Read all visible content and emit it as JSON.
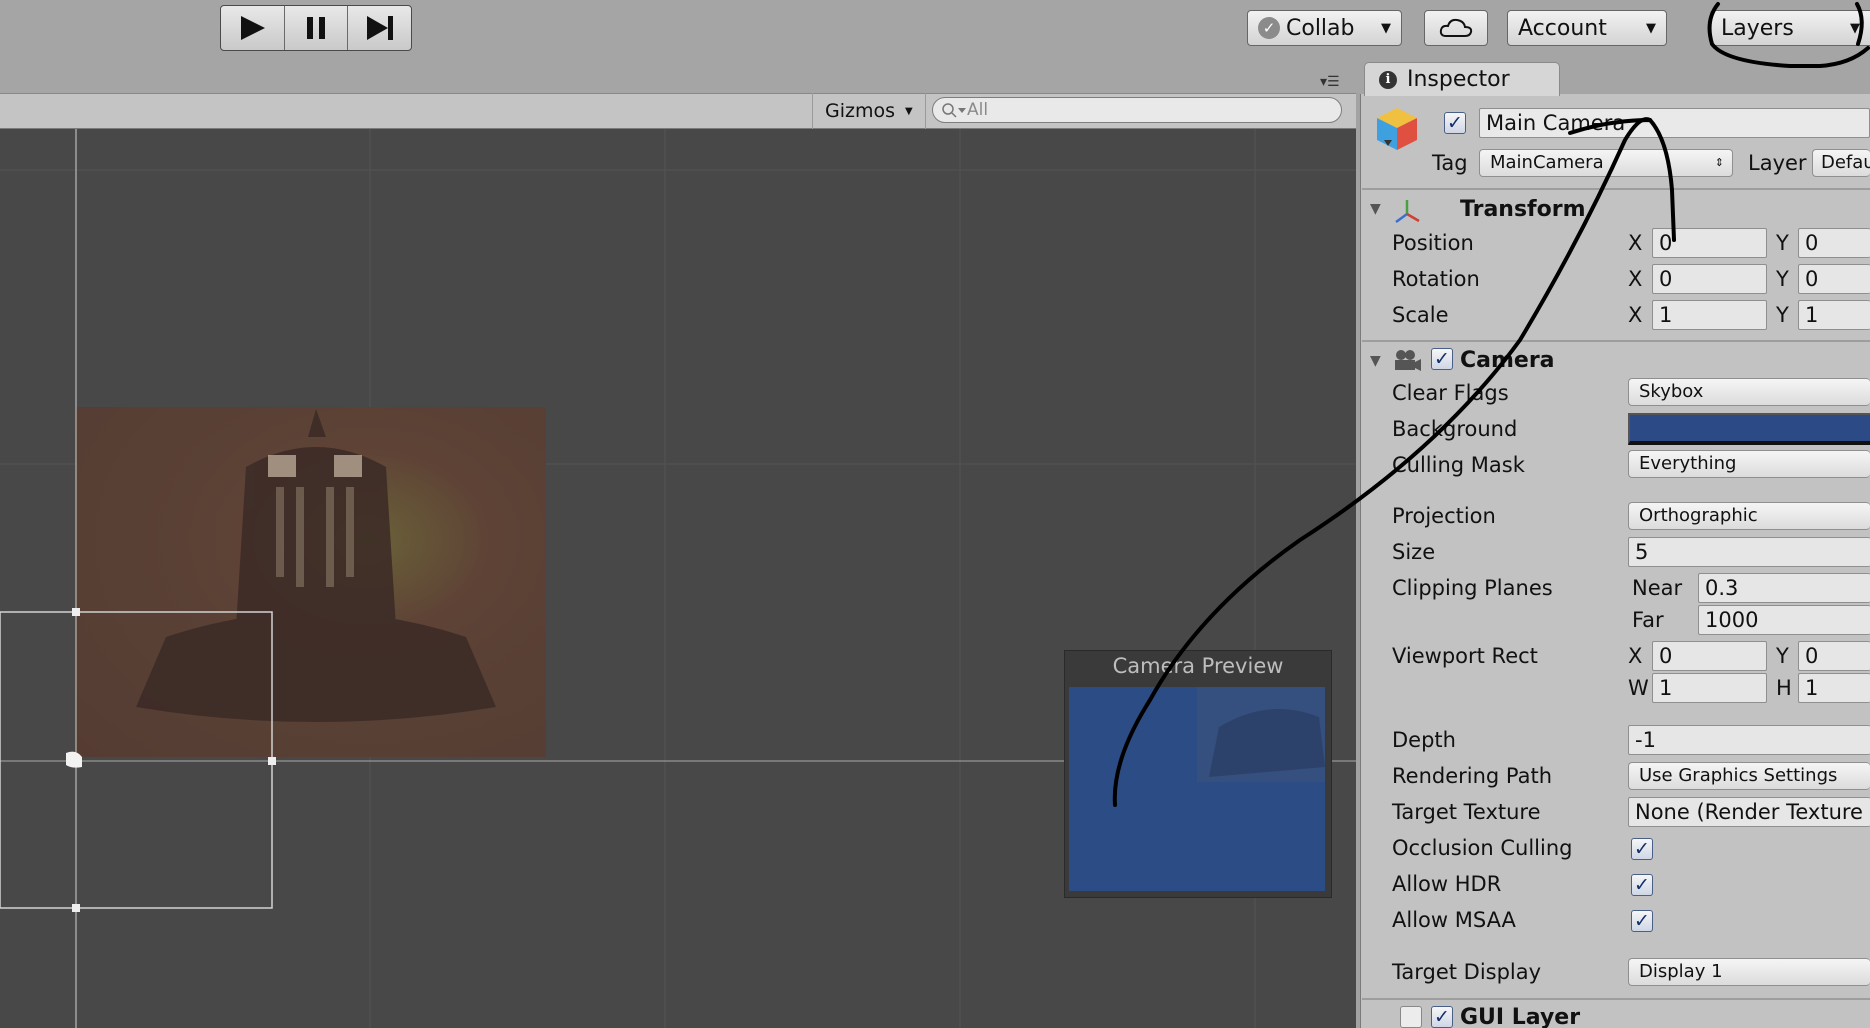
{
  "toolbar": {
    "play_icon": "play-icon",
    "pause_icon": "pause-icon",
    "step_icon": "step-icon",
    "collab_label": "Collab",
    "account_label": "Account",
    "layers_label": "Layers"
  },
  "scene": {
    "gizmos_label": "Gizmos",
    "search_placeholder": "All"
  },
  "camera_preview": {
    "title": "Camera Preview"
  },
  "inspector": {
    "tab_label": "Inspector",
    "object_name": "Main Camera",
    "tag_label": "Tag",
    "tag_value": "MainCamera",
    "layer_label": "Layer",
    "layer_value": "Defau",
    "transform": {
      "title": "Transform",
      "rows": [
        {
          "label": "Position",
          "x": "0",
          "y": "0"
        },
        {
          "label": "Rotation",
          "x": "0",
          "y": "0"
        },
        {
          "label": "Scale",
          "x": "1",
          "y": "1"
        }
      ],
      "x_label": "X",
      "y_label": "Y"
    },
    "camera": {
      "title": "Camera",
      "clear_flags_label": "Clear Flags",
      "clear_flags_value": "Skybox",
      "background_label": "Background",
      "background_color": "#2b4a86",
      "culling_mask_label": "Culling Mask",
      "culling_mask_value": "Everything",
      "projection_label": "Projection",
      "projection_value": "Orthographic",
      "size_label": "Size",
      "size_value": "5",
      "clipping_label": "Clipping Planes",
      "near_label": "Near",
      "near_value": "0.3",
      "far_label": "Far",
      "far_value": "1000",
      "viewport_label": "Viewport Rect",
      "viewport_x_label": "X",
      "viewport_x": "0",
      "viewport_y_label": "Y",
      "viewport_y": "0",
      "viewport_w_label": "W",
      "viewport_w": "1",
      "viewport_h_label": "H",
      "viewport_h": "1",
      "depth_label": "Depth",
      "depth_value": "-1",
      "rendering_path_label": "Rendering Path",
      "rendering_path_value": "Use Graphics Settings",
      "target_texture_label": "Target Texture",
      "target_texture_value": "None (Render Texture",
      "occlusion_label": "Occlusion Culling",
      "hdr_label": "Allow HDR",
      "msaa_label": "Allow MSAA",
      "target_display_label": "Target Display",
      "target_display_value": "Display 1"
    },
    "gui_layer": {
      "title": "GUI Layer"
    }
  },
  "colors": {
    "accent_blue": "#2c4c85",
    "annotation_ink": "#000000"
  }
}
